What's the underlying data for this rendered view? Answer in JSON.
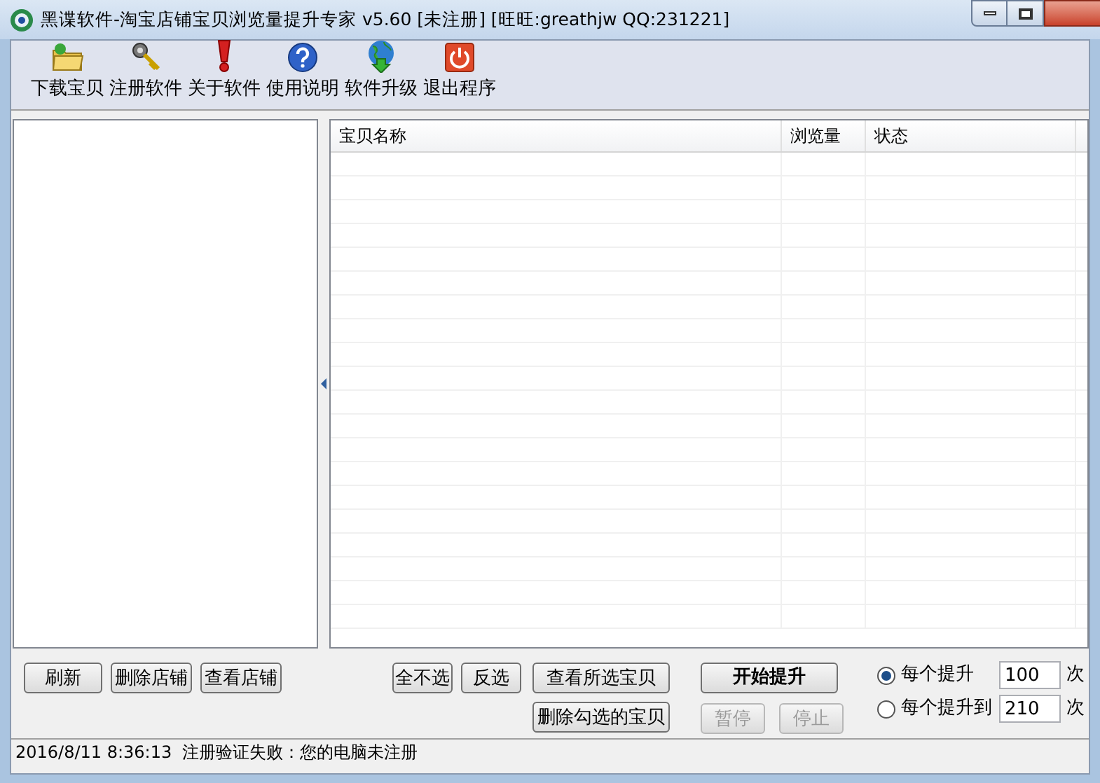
{
  "window": {
    "title": "黑谍软件-淘宝店铺宝贝浏览量提升专家 v5.60 [未注册] [旺旺:greathjw QQ:231221]"
  },
  "toolbar": [
    {
      "label": "下载宝贝",
      "kind": "folder"
    },
    {
      "label": "注册软件",
      "kind": "key"
    },
    {
      "label": "关于软件",
      "kind": "alert"
    },
    {
      "label": "使用说明",
      "kind": "help"
    },
    {
      "label": "软件升级",
      "kind": "globe"
    },
    {
      "label": "退出程序",
      "kind": "power"
    }
  ],
  "table": {
    "columns": [
      "宝贝名称",
      "浏览量",
      "状态"
    ]
  },
  "buttons_left": [
    {
      "label": "刷新",
      "disabled": false
    },
    {
      "label": "删除店铺",
      "disabled": false
    },
    {
      "label": "查看店铺",
      "disabled": false
    }
  ],
  "buttons_mid": [
    {
      "label": "全不选",
      "disabled": false
    },
    {
      "label": "反选",
      "disabled": false
    },
    {
      "label": "查看所选宝贝",
      "disabled": false
    },
    {
      "label": "删除勾选的宝贝",
      "disabled": false
    }
  ],
  "start_button": {
    "label": "开始提升"
  },
  "control_buttons": [
    {
      "label": "暂停",
      "disabled": true
    },
    {
      "label": "停止",
      "disabled": true
    }
  ],
  "modes": [
    {
      "label": "每个提升",
      "value": "100",
      "unit": "次",
      "selected": true
    },
    {
      "label": "每个提升到",
      "value": "210",
      "unit": "次",
      "selected": false
    }
  ],
  "status_bar": "2016/8/11 8:36:13  注册验证失败：您的电脑未注册"
}
